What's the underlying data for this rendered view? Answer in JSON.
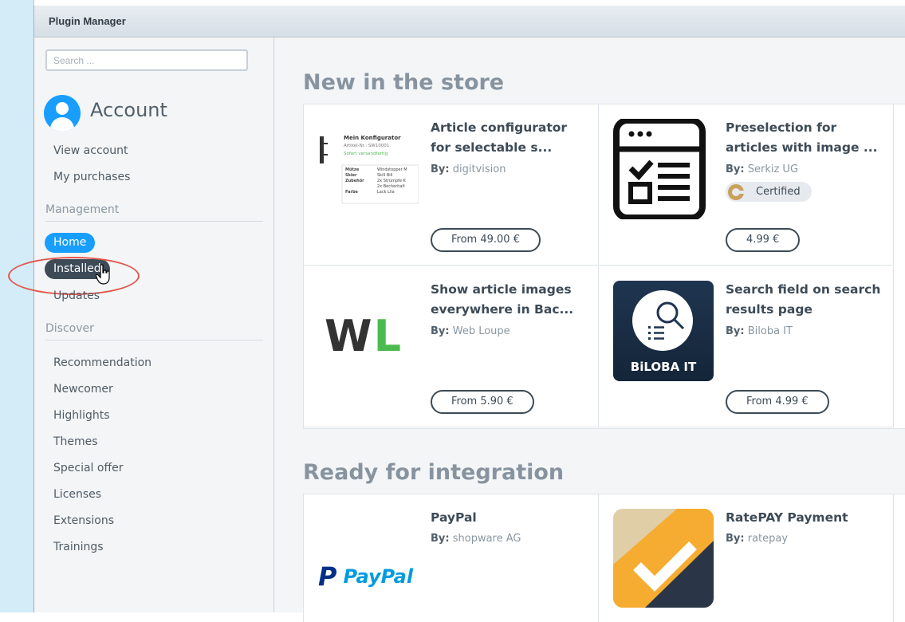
{
  "window": {
    "title": "Plugin Manager"
  },
  "sidebar": {
    "search_placeholder": "Search ...",
    "account_title": "Account",
    "account_items": [
      "View account",
      "My purchases"
    ],
    "management_label": "Management",
    "management_items": [
      "Home",
      "Installed",
      "Updates"
    ],
    "discover_label": "Discover",
    "discover_items": [
      "Recommendation",
      "Newcomer",
      "Highlights",
      "Themes",
      "Special offer",
      "Licenses",
      "Extensions",
      "Trainings"
    ]
  },
  "sections": [
    {
      "title": "New in the store",
      "plugins": [
        {
          "name": "Article configurator for selectable s...",
          "by_label": "By:",
          "vendor": "digitvision",
          "price": "From 49.00 €",
          "thumb": {
            "title": "Mein Konfigurator",
            "sku": "Artikel-Nr.: SW10001",
            "stock": "Sofort versandfertig",
            "rows": [
              [
                "Mütze",
                "Windstopper M"
              ],
              [
                "Skier",
                "Skill Bill"
              ],
              [
                "Zubehör",
                "2x Strümpfe K"
              ],
              [
                "",
                "2x Becherhalt"
              ],
              [
                "Farbe",
                "Lack Lila"
              ]
            ]
          }
        },
        {
          "name": "Preselection for articles with image ...",
          "by_label": "By:",
          "vendor": "Serkiz UG",
          "price": "4.99 €",
          "certified": "Certified"
        },
        {
          "name": "Show article images everywhere in Bac...",
          "by_label": "By:",
          "vendor": "Web Loupe",
          "price": "From 5.90 €",
          "logo": {
            "w": "W",
            "l": "L"
          }
        },
        {
          "name": "Search field on search results page",
          "by_label": "By:",
          "vendor": "Biloba IT",
          "price": "From 4.99 €",
          "logo": {
            "text": "BiLOBA IT"
          }
        }
      ]
    },
    {
      "title": "Ready for integration",
      "plugins": [
        {
          "name": "PayPal",
          "by_label": "By:",
          "vendor": "shopware AG",
          "logo": {
            "p": "P",
            "text": "PayPal"
          }
        },
        {
          "name": "RatePAY Payment",
          "by_label": "By:",
          "vendor": "ratepay"
        }
      ]
    }
  ],
  "colors": {
    "accent": "#189eff",
    "dark": "#3d4b57",
    "annotation": "#e2574c",
    "wl_green": "#4cbb4f"
  }
}
